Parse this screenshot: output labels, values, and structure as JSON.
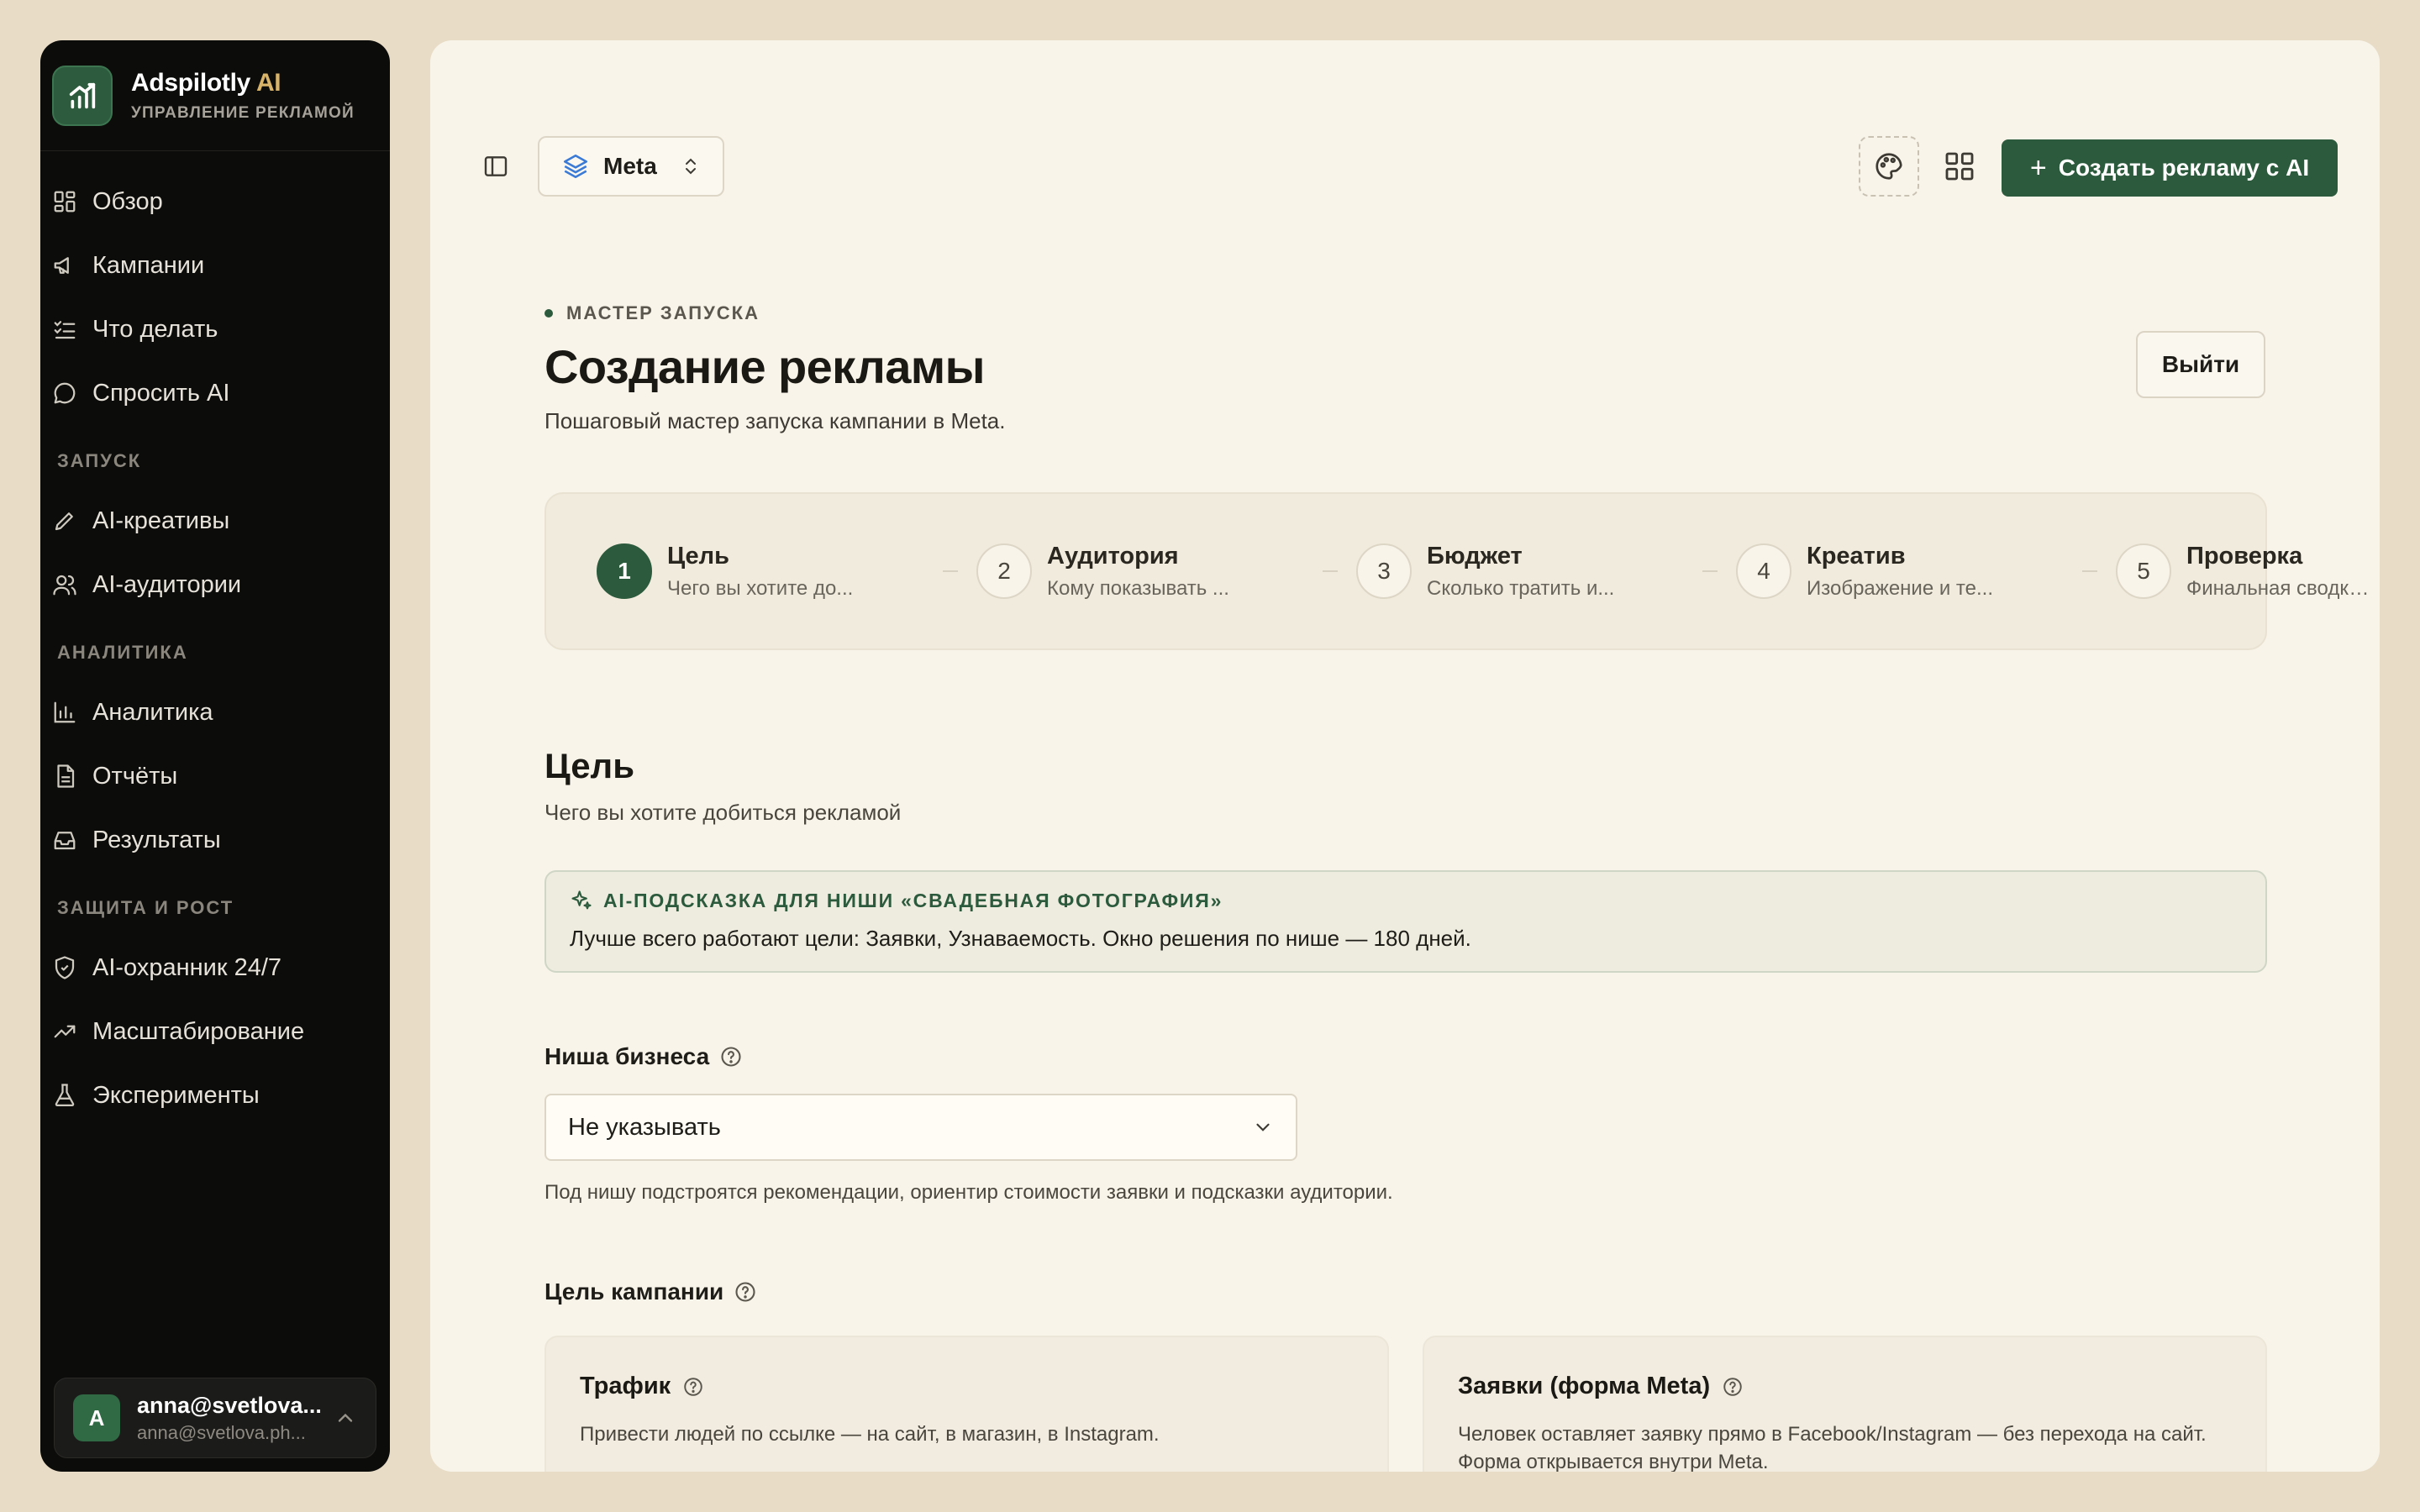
{
  "brand": {
    "name": "Adspilotly",
    "name_accent": "AI",
    "subtitle": "УПРАВЛЕНИЕ РЕКЛАМОЙ"
  },
  "sidebar": {
    "items_main": [
      {
        "label": "Обзор",
        "icon": "grid-icon"
      },
      {
        "label": "Кампании",
        "icon": "megaphone-icon"
      },
      {
        "label": "Что делать",
        "icon": "checklist-icon"
      },
      {
        "label": "Спросить AI",
        "icon": "chat-icon"
      }
    ],
    "section_launch": "ЗАПУСК",
    "items_launch": [
      {
        "label": "AI-креативы",
        "icon": "pen-icon"
      },
      {
        "label": "AI-аудитории",
        "icon": "users-icon"
      }
    ],
    "section_analytics": "АНАЛИТИКА",
    "items_analytics": [
      {
        "label": "Аналитика",
        "icon": "bar-chart-icon"
      },
      {
        "label": "Отчёты",
        "icon": "document-icon"
      },
      {
        "label": "Результаты",
        "icon": "inbox-icon"
      }
    ],
    "section_growth": "ЗАЩИТА И РОСТ",
    "items_growth": [
      {
        "label": "AI-охранник 24/7",
        "icon": "shield-icon"
      },
      {
        "label": "Масштабирование",
        "icon": "trending-up-icon"
      },
      {
        "label": "Эксперименты",
        "icon": "flask-icon"
      }
    ],
    "user": {
      "initial": "A",
      "name": "anna@svetlova...",
      "email": "anna@svetlova.ph..."
    }
  },
  "header": {
    "platform": "Meta",
    "create_button": "Создать рекламу с AI"
  },
  "page": {
    "eyebrow": "МАСТЕР ЗАПУСКА",
    "title": "Создание рекламы",
    "subtitle": "Пошаговый мастер запуска кампании в Meta.",
    "exit_button": "Выйти"
  },
  "steps": [
    {
      "num": "1",
      "title": "Цель",
      "desc": "Чего вы хотите до...",
      "active": true
    },
    {
      "num": "2",
      "title": "Аудитория",
      "desc": "Кому показывать ...",
      "active": false
    },
    {
      "num": "3",
      "title": "Бюджет",
      "desc": "Сколько тратить и...",
      "active": false
    },
    {
      "num": "4",
      "title": "Креатив",
      "desc": "Изображение и те...",
      "active": false
    },
    {
      "num": "5",
      "title": "Проверка",
      "desc": "Финальная сводка и п...",
      "active": false
    }
  ],
  "goal_section": {
    "title": "Цель",
    "subtitle": "Чего вы хотите добиться рекламой"
  },
  "ai_hint": {
    "heading": "AI-ПОДСКАЗКА ДЛЯ НИШИ «СВАДЕБНАЯ ФОТОГРАФИЯ»",
    "body": "Лучше всего работают цели: Заявки, Узнаваемость. Окно решения по нише — 180 дней."
  },
  "niche": {
    "label": "Ниша бизнеса",
    "value": "Не указывать",
    "help": "Под нишу подстроятся рекомендации, ориентир стоимости заявки и подсказки аудитории."
  },
  "objective": {
    "label": "Цель кампании",
    "cards": [
      {
        "title": "Трафик",
        "desc": "Привести людей по ссылке — на сайт, в магазин, в Instagram."
      },
      {
        "title": "Заявки (форма Meta)",
        "desc": "Человек оставляет заявку прямо в Facebook/Instagram — без перехода на сайт. Форма открывается внутри Meta."
      }
    ]
  },
  "colors": {
    "accent": "#2c5a3c",
    "gold": "#d8b36a",
    "sidebar_bg": "#0c0c0b",
    "page_bg": "#f8f4ea"
  }
}
